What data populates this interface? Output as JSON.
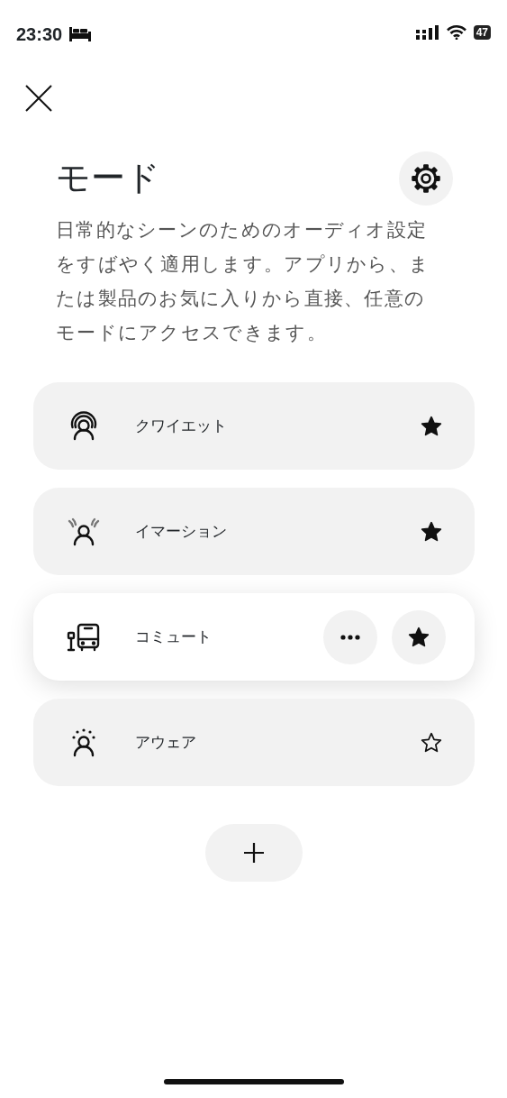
{
  "status_bar": {
    "time": "23:30",
    "battery": "47"
  },
  "title": "モード",
  "description": "日常的なシーンのためのオーディオ設定をすばやく適用します。アプリから、または製品のお気に入りから直接、任意のモードにアクセスできます。",
  "modes": [
    {
      "kind": "quiet",
      "label": "クワイエット",
      "favorite": true,
      "selected": false
    },
    {
      "kind": "immersion",
      "label": "イマーション",
      "favorite": true,
      "selected": false
    },
    {
      "kind": "commute",
      "label": "コミュート",
      "favorite": true,
      "selected": true
    },
    {
      "kind": "aware",
      "label": "アウェア",
      "favorite": false,
      "selected": false
    }
  ]
}
